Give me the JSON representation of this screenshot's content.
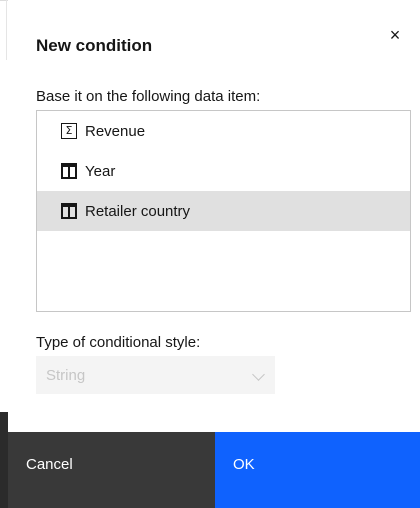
{
  "dialog": {
    "title": "New condition",
    "close_icon": "close-icon",
    "close_glyph": "×"
  },
  "data_item": {
    "label": "Base it on the following data item:",
    "items": [
      {
        "label": "Revenue",
        "icon": "measure-sigma-icon",
        "selected": false
      },
      {
        "label": "Year",
        "icon": "dimension-icon",
        "selected": false
      },
      {
        "label": "Retailer country",
        "icon": "dimension-icon",
        "selected": true
      }
    ]
  },
  "style_type": {
    "label": "Type of conditional style:",
    "selected_value": "String",
    "disabled": true
  },
  "footer": {
    "cancel_label": "Cancel",
    "ok_label": "OK"
  },
  "colors": {
    "primary": "#0f62fe",
    "secondary": "#393939",
    "selected_row": "#e0e0e0"
  }
}
